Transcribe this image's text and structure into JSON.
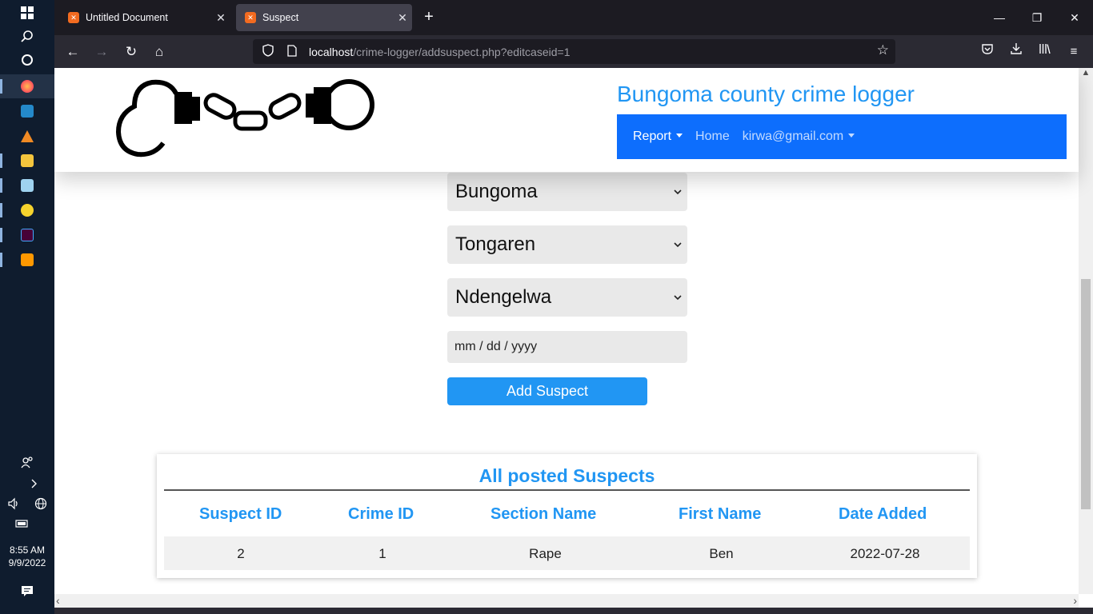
{
  "taskbar": {
    "clock_time": "8:55 AM",
    "clock_date": "9/9/2022",
    "icons": [
      "windows-icon",
      "search-icon",
      "cortana-icon",
      "firefox-icon",
      "vscode-icon",
      "vlc-icon",
      "file-explorer-icon",
      "notepad-icon",
      "xampp-icon",
      "dreamweaver-icon",
      "sublime-icon"
    ]
  },
  "browser": {
    "tabs": [
      {
        "title": "Untitled Document"
      },
      {
        "title": "Suspect"
      }
    ],
    "url_host": "localhost",
    "url_path": "/crime-logger/addsuspect.php?editcaseid=1"
  },
  "header": {
    "site_title": "Bungoma county crime logger",
    "menu": {
      "report": "Report",
      "home": "Home",
      "user": "kirwa@gmail.com"
    }
  },
  "form": {
    "county": "Bungoma",
    "subcounty": "Tongaren",
    "ward": "Ndengelwa",
    "date_placeholder": "mm / dd / yyyy",
    "submit_label": "Add Suspect"
  },
  "suspects_table": {
    "title": "All posted Suspects",
    "headers": [
      "Suspect ID",
      "Crime ID",
      "Section Name",
      "First Name",
      "Date Added"
    ],
    "rows": [
      [
        "2",
        "1",
        "Rape",
        "Ben",
        "2022-07-28"
      ]
    ]
  },
  "colors": {
    "accent_blue": "#2196f3",
    "nav_blue": "#0d6efd"
  }
}
